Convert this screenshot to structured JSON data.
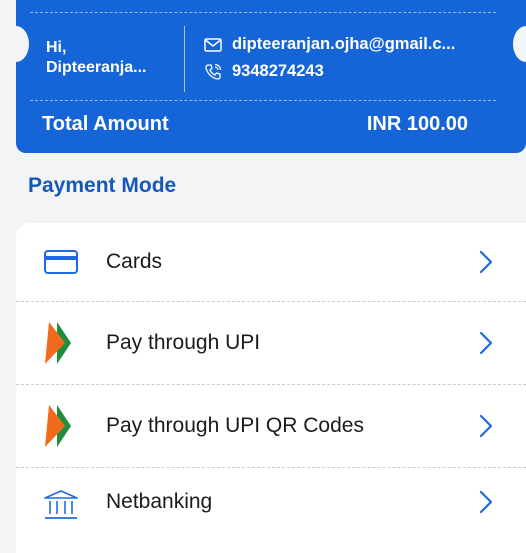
{
  "header": {
    "greeting_line1": "Hi,",
    "greeting_line2": "Dipteeranja...",
    "email": "dipteeranjan.ojha@gmail.c...",
    "phone": "9348274243",
    "total_label": "Total Amount",
    "total_value": "INR 100.00"
  },
  "section": {
    "title": "Payment Mode"
  },
  "payment_modes": [
    {
      "label": "Cards",
      "icon": "card-icon"
    },
    {
      "label": "Pay through UPI",
      "icon": "upi-icon"
    },
    {
      "label": "Pay through UPI QR Codes",
      "icon": "upi-icon"
    },
    {
      "label": "Netbanking",
      "icon": "bank-icon"
    }
  ],
  "colors": {
    "brand_blue": "#1565d8",
    "title_blue": "#1558b9",
    "chevron_blue": "#1f6ae0",
    "upi_orange": "#f26b1d",
    "upi_green": "#1e8e3e"
  }
}
